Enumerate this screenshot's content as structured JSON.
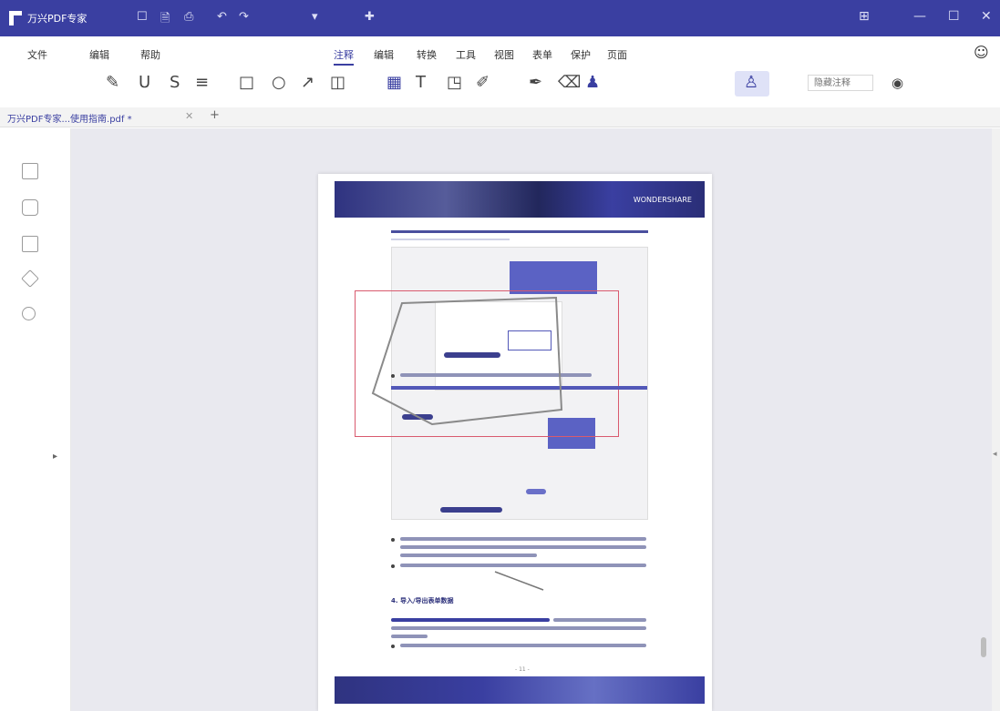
{
  "app": {
    "title": "万兴PDF专家",
    "quick_icons": [
      "☐",
      "🗎",
      "⎙",
      "↶",
      "↷",
      "▾",
      "✚"
    ],
    "window_controls": [
      "⊞",
      "—",
      "☐",
      "✕"
    ]
  },
  "menu": {
    "items": [
      "文件",
      "编辑",
      "帮助",
      "注释",
      "编辑",
      "转换",
      "工具",
      "视图",
      "表单",
      "保护",
      "页面"
    ],
    "active_index": 3
  },
  "toolbar": {
    "tools": [
      "highlight-icon",
      "underline-icon",
      "strikethrough-icon",
      "text-note-icon",
      "rectangle-icon",
      "circle-icon",
      "arrow-icon",
      "shape-more-icon",
      "textbox-icon",
      "typewriter-icon",
      "callout-icon",
      "pencil-icon",
      "pen-icon",
      "eraser-icon",
      "stamp-icon",
      "signature-icon"
    ],
    "zoom_placeholder": "隐藏注释",
    "eye_icon": "eye-icon"
  },
  "tab": {
    "label": "万兴PDF专家...使用指南.pdf *",
    "close": "✕",
    "add": "+"
  },
  "sidebar": {
    "icons": [
      "bookmark-icon",
      "comment-icon",
      "thumbnail-icon",
      "attachment-icon",
      "search-icon"
    ],
    "toggle": "▸"
  },
  "document": {
    "banner_text": "WONDERSHARE",
    "page_number": "- 11 -",
    "heading": "4. 导入/导出表单数据"
  },
  "colors": {
    "brand": "#3a3fa1",
    "annotation_red": "#d95a6e",
    "annotation_blue": "#5258b8"
  }
}
